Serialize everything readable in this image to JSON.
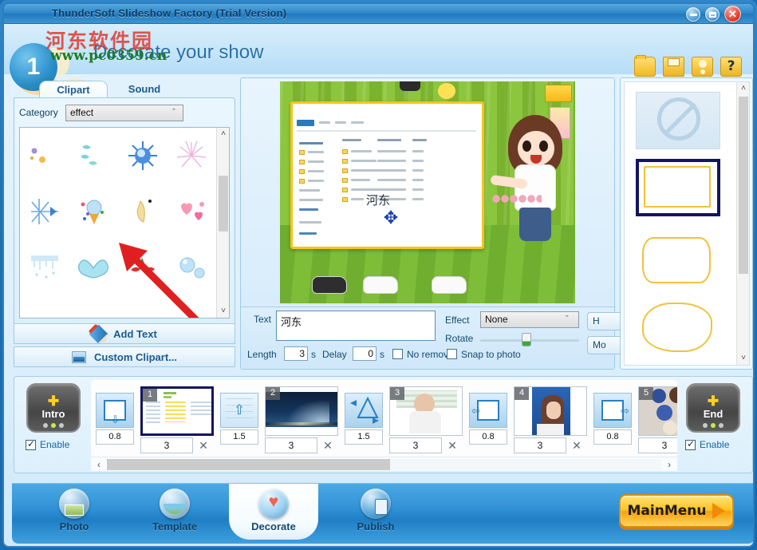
{
  "window": {
    "title": "ThunderSoft Slideshow Factory (Trial Version)",
    "minimize_label": "–",
    "maximize_label": "□",
    "close_label": "✕"
  },
  "header": {
    "title": "Decorate your show",
    "watermark_cn": "河东软件园",
    "watermark_url": "www.pc0359.cn",
    "watermark_badge": "1",
    "tools": [
      {
        "name": "open-folder-icon",
        "label": ""
      },
      {
        "name": "save-icon",
        "label": ""
      },
      {
        "name": "support-icon",
        "label": ""
      },
      {
        "name": "help-icon",
        "label": "?"
      }
    ]
  },
  "left_panel": {
    "tabs": [
      {
        "label": "Clipart",
        "active": true
      },
      {
        "label": "Sound",
        "active": false
      }
    ],
    "category_label": "Category",
    "category_value": "effect",
    "chevron": "ˇ",
    "clipart_items": [
      "✦",
      "✿",
      "✹",
      "✸",
      "✴",
      "❇",
      "✨",
      "❥",
      "❄",
      "ᾘb",
      "❁",
      "●",
      "■",
      "●",
      "",
      ""
    ],
    "add_text_label": "Add Text",
    "custom_clipart_label": "Custom Clipart...",
    "scroll_up": "˄",
    "scroll_down": "˅"
  },
  "preview": {
    "overlay_text": "河东",
    "move_cursor": "✥"
  },
  "text_bar": {
    "text_label": "Text",
    "text_value": "河东",
    "length_label": "Length",
    "length_value": "3",
    "length_unit": "s",
    "delay_label": "Delay",
    "delay_value": "0",
    "delay_unit": "s",
    "no_remove_label": "No remove",
    "no_remove_checked": false,
    "snap_label": "Snap to photo",
    "snap_checked": false,
    "effect_label": "Effect",
    "effect_value": "None",
    "effect_chevron": "ˇ",
    "rotate_label": "Rotate",
    "rotate_value": 42,
    "hide_button_label": "H",
    "more_button_label": "Mo"
  },
  "right_panel": {
    "frames": [
      {
        "name": "frame-none",
        "label": ""
      },
      {
        "name": "frame-rectangle",
        "label": "",
        "selected": true
      },
      {
        "name": "frame-rounded",
        "label": ""
      },
      {
        "name": "frame-cloud",
        "label": ""
      }
    ]
  },
  "filmstrip": {
    "intro": {
      "label": "Intro",
      "plus": "✚",
      "enable_label": "Enable",
      "enabled": true
    },
    "end": {
      "label": "End",
      "plus": "✚",
      "enable_label": "Enable",
      "enabled": true
    },
    "transitions": [
      {
        "value": "0.8",
        "arrow": "⇩"
      },
      {
        "value": "1.5",
        "arrow": "⇧"
      },
      {
        "value": "1.5",
        "arrow": "↗"
      },
      {
        "value": "0.8",
        "arrow": "⇦"
      },
      {
        "value": "0.8",
        "arrow": "⇨"
      }
    ],
    "slides": [
      {
        "number": "1",
        "duration": "3",
        "delete": "✕",
        "selected": true,
        "kind": "explorer"
      },
      {
        "number": "2",
        "duration": "3",
        "delete": "✕",
        "selected": false,
        "kind": "night"
      },
      {
        "number": "3",
        "duration": "3",
        "delete": "✕",
        "selected": false,
        "kind": "portrait1"
      },
      {
        "number": "4",
        "duration": "3",
        "delete": "✕",
        "selected": false,
        "kind": "portrait2"
      },
      {
        "number": "5",
        "duration": "3",
        "delete": "",
        "selected": false,
        "kind": "collage"
      }
    ],
    "scroll_left": "‹",
    "scroll_right": "›"
  },
  "bottom_nav": {
    "items": [
      {
        "label": "Photo",
        "active": false
      },
      {
        "label": "Template",
        "active": false
      },
      {
        "label": "Decorate",
        "active": true
      },
      {
        "label": "Publish",
        "active": false
      }
    ],
    "main_menu_label": "MainMenu"
  },
  "colors": {
    "accent_blue": "#2d86c8",
    "panel_blue": "#dff0fb",
    "select_navy": "#12165e",
    "frame_gold": "#f0c33c",
    "mainmenu_orange": "#fdc21e",
    "close_red": "#e23c2c"
  }
}
